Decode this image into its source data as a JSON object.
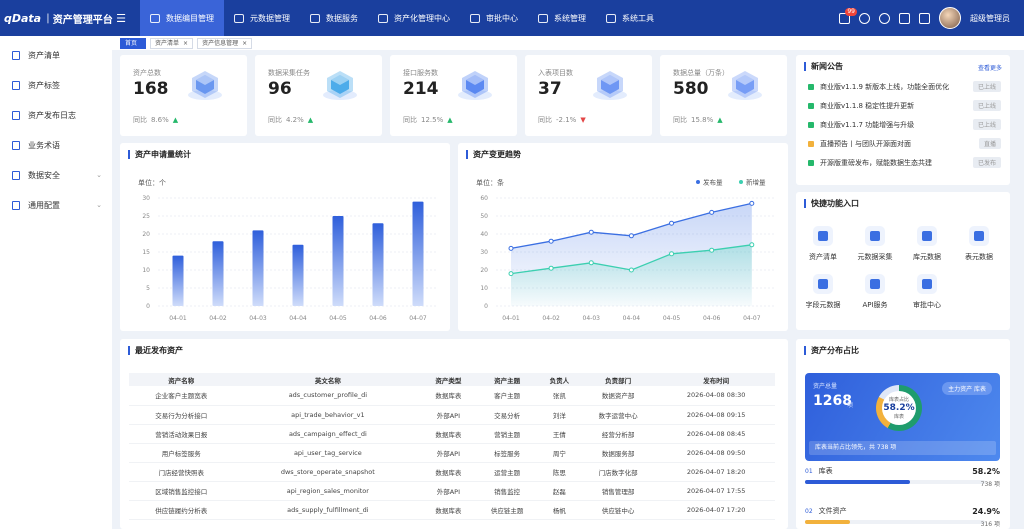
{
  "brand": {
    "logo": "qData",
    "divider": "|",
    "title": "资产管理平台"
  },
  "nav": [
    {
      "label": "数据编目管理",
      "active": true
    },
    {
      "label": "元数据管理",
      "active": false
    },
    {
      "label": "数据服务",
      "active": false
    },
    {
      "label": "资产化管理中心",
      "active": false
    },
    {
      "label": "审批中心",
      "active": false
    },
    {
      "label": "系统管理",
      "active": false
    },
    {
      "label": "系统工具",
      "active": false
    }
  ],
  "notification_count": "99",
  "username": "超级管理员",
  "sidebar": [
    {
      "label": "资产清单",
      "chevron": ""
    },
    {
      "label": "资产标签",
      "chevron": ""
    },
    {
      "label": "资产发布日志",
      "chevron": ""
    },
    {
      "label": "业务术语",
      "chevron": ""
    },
    {
      "label": "数据安全",
      "chevron": "⌄"
    },
    {
      "label": "通用配置",
      "chevron": "⌄"
    }
  ],
  "tabs": [
    {
      "label": "首页",
      "close": ""
    },
    {
      "label": "资产清单",
      "close": "×"
    },
    {
      "label": "资产信息管理",
      "close": "×"
    }
  ],
  "stats": [
    {
      "label": "资产总数",
      "value": "168",
      "foot": "同比",
      "pct": "8.6%",
      "trend": "▲",
      "dir": "up"
    },
    {
      "label": "数据采集任务",
      "value": "96",
      "foot": "同比",
      "pct": "4.2%",
      "trend": "▲",
      "dir": "up"
    },
    {
      "label": "接口服务数",
      "value": "214",
      "foot": "同比",
      "pct": "12.5%",
      "trend": "▲",
      "dir": "up"
    },
    {
      "label": "入表项目数",
      "value": "37",
      "foot": "同比",
      "pct": "-2.1%",
      "trend": "▼",
      "dir": "down"
    },
    {
      "label": "数据总量（万条）",
      "value": "580",
      "foot": "同比",
      "pct": "15.8%",
      "trend": "▲",
      "dir": "up"
    }
  ],
  "bar_title": "资产申请量统计",
  "line_title": "资产变更趋势",
  "chart_data": [
    {
      "type": "bar",
      "title": "资产申请量统计",
      "unit_label": "单位：个",
      "categories": [
        "04-01",
        "04-02",
        "04-03",
        "04-04",
        "04-05",
        "04-06",
        "04-07"
      ],
      "values": [
        14,
        18,
        21,
        17,
        25,
        23,
        29
      ],
      "ylim": [
        0,
        30
      ],
      "yticks": [
        0,
        5,
        10,
        15,
        20,
        25,
        30
      ],
      "grid": true
    },
    {
      "type": "line",
      "title": "资产变更趋势",
      "unit_label": "单位：条",
      "categories": [
        "04-01",
        "04-02",
        "04-03",
        "04-04",
        "04-05",
        "04-06",
        "04-07"
      ],
      "ylim": [
        0,
        60
      ],
      "yticks": [
        0,
        10,
        20,
        30,
        40,
        50,
        60
      ],
      "legend_position": "top-right",
      "grid": true,
      "series": [
        {
          "name": "发布量",
          "color": "#3b6fe2",
          "values": [
            32,
            36,
            41,
            39,
            46,
            52,
            57
          ]
        },
        {
          "name": "新增量",
          "color": "#3ccfb0",
          "values": [
            18,
            21,
            24,
            20,
            29,
            31,
            34
          ]
        }
      ]
    }
  ],
  "news": {
    "title": "新闻公告",
    "more": "查看更多",
    "items": [
      {
        "text": "商业版v1.1.9 新版本上线，功能全面优化",
        "tag": "已上线",
        "color": "#25b86b"
      },
      {
        "text": "商业版v1.1.8 稳定性提升更新",
        "tag": "已上线",
        "color": "#25b86b"
      },
      {
        "text": "商业版v1.1.7 功能增强与升级",
        "tag": "已上线",
        "color": "#25b86b"
      },
      {
        "text": "直播预告丨与团队开源面对面",
        "tag": "直播",
        "color": "#f2b13c"
      },
      {
        "text": "开源版重磅发布，赋能数据生态共建",
        "tag": "已发布",
        "color": "#25b86b"
      }
    ]
  },
  "quick": {
    "title": "快捷功能入口",
    "items": [
      "资产清单",
      "元数据采集",
      "库元数据",
      "表元数据",
      "字段元数据",
      "API服务",
      "审批中心"
    ]
  },
  "recent": {
    "title": "最近发布资产",
    "headers": [
      "资产名称",
      "英文名称",
      "资产类型",
      "资产主题",
      "负责人",
      "负责部门",
      "发布时间"
    ],
    "rows": [
      [
        "企业客户主题宽表",
        "ads_customer_profile_di",
        "数据库表",
        "客户主题",
        "张凯",
        "数据资产部",
        "2026-04-08 08:30"
      ],
      [
        "交易行为分析接口",
        "api_trade_behavior_v1",
        "外部API",
        "交易分析",
        "刘洋",
        "数字运营中心",
        "2026-04-08 09:15"
      ],
      [
        "营销活动效果日报",
        "ads_campaign_effect_di",
        "数据库表",
        "营销主题",
        "王倩",
        "经营分析部",
        "2026-04-08 08:45"
      ],
      [
        "用户标签服务",
        "api_user_tag_service",
        "外部API",
        "标签服务",
        "周宁",
        "数据服务部",
        "2026-04-08 09:50"
      ],
      [
        "门店经营快照表",
        "dws_store_operate_snapshot",
        "数据库表",
        "运营主题",
        "陈思",
        "门店数字化部",
        "2026-04-07 18:20"
      ],
      [
        "区域销售监控接口",
        "api_region_sales_monitor",
        "外部API",
        "销售监控",
        "赵磊",
        "销售管理部",
        "2026-04-07 17:55"
      ],
      [
        "供应链履约分析表",
        "ads_supply_fulfillment_di",
        "数据库表",
        "供应链主题",
        "杨帆",
        "供应链中心",
        "2026-04-07 17:20"
      ]
    ]
  },
  "distribution": {
    "title": "资产分布占比",
    "total_label": "资产总量",
    "total": "1268",
    "unit": "项",
    "button": "主力资产 库表",
    "ring_caption": "库表占比",
    "ring_value": "58.2%",
    "ring_sub": "库表",
    "note": "库表当前占比领先，共 738 项",
    "rows": [
      {
        "num": "01",
        "name": "库表",
        "pct": "58.2%",
        "fill": 0.582,
        "count": "738 项"
      },
      {
        "num": "02",
        "name": "文件资产",
        "pct": "24.9%",
        "fill": 0.249,
        "count": "316 项"
      }
    ]
  }
}
